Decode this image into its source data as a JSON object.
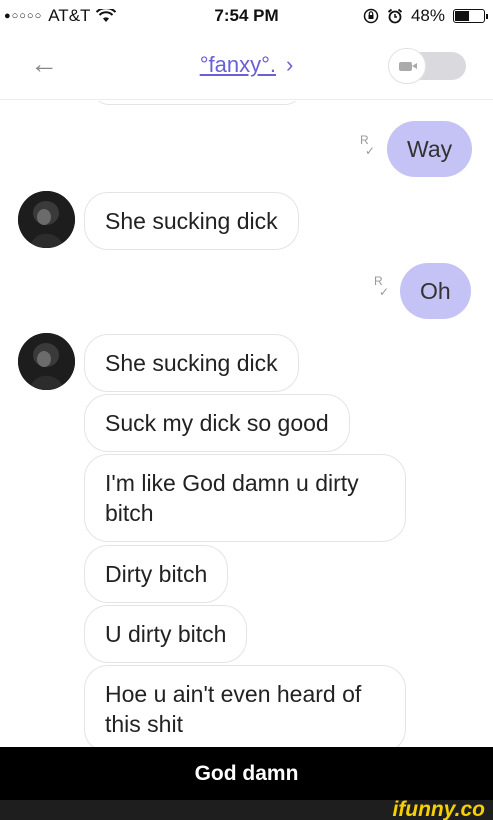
{
  "status_bar": {
    "signal": "●○○○○",
    "carrier": "AT&T",
    "time": "7:54 PM",
    "battery_percent": "48%",
    "battery_level": 0.48
  },
  "nav": {
    "back_icon": "←",
    "contact_name": "°fanxy°.",
    "chevron": "›"
  },
  "messages": {
    "out_1": "Way",
    "in_1": "She sucking dick",
    "out_2": "Oh",
    "in_2": "She sucking dick",
    "in_3": "Suck my dick so good",
    "in_4": "I'm like God damn u dirty bitch",
    "in_5": "Dirty bitch",
    "in_6": "U dirty bitch",
    "in_7": "Hoe u ain't even heard of this shit"
  },
  "read_receipt": {
    "r": "R",
    "check": "✓"
  },
  "caption": "God damn",
  "watermark": "ifunny.co",
  "colors": {
    "outgoing_bubble": "#c5c2f5",
    "accent": "#6b5fd6",
    "caption_bg": "#000000",
    "watermark": "#f5d000"
  }
}
